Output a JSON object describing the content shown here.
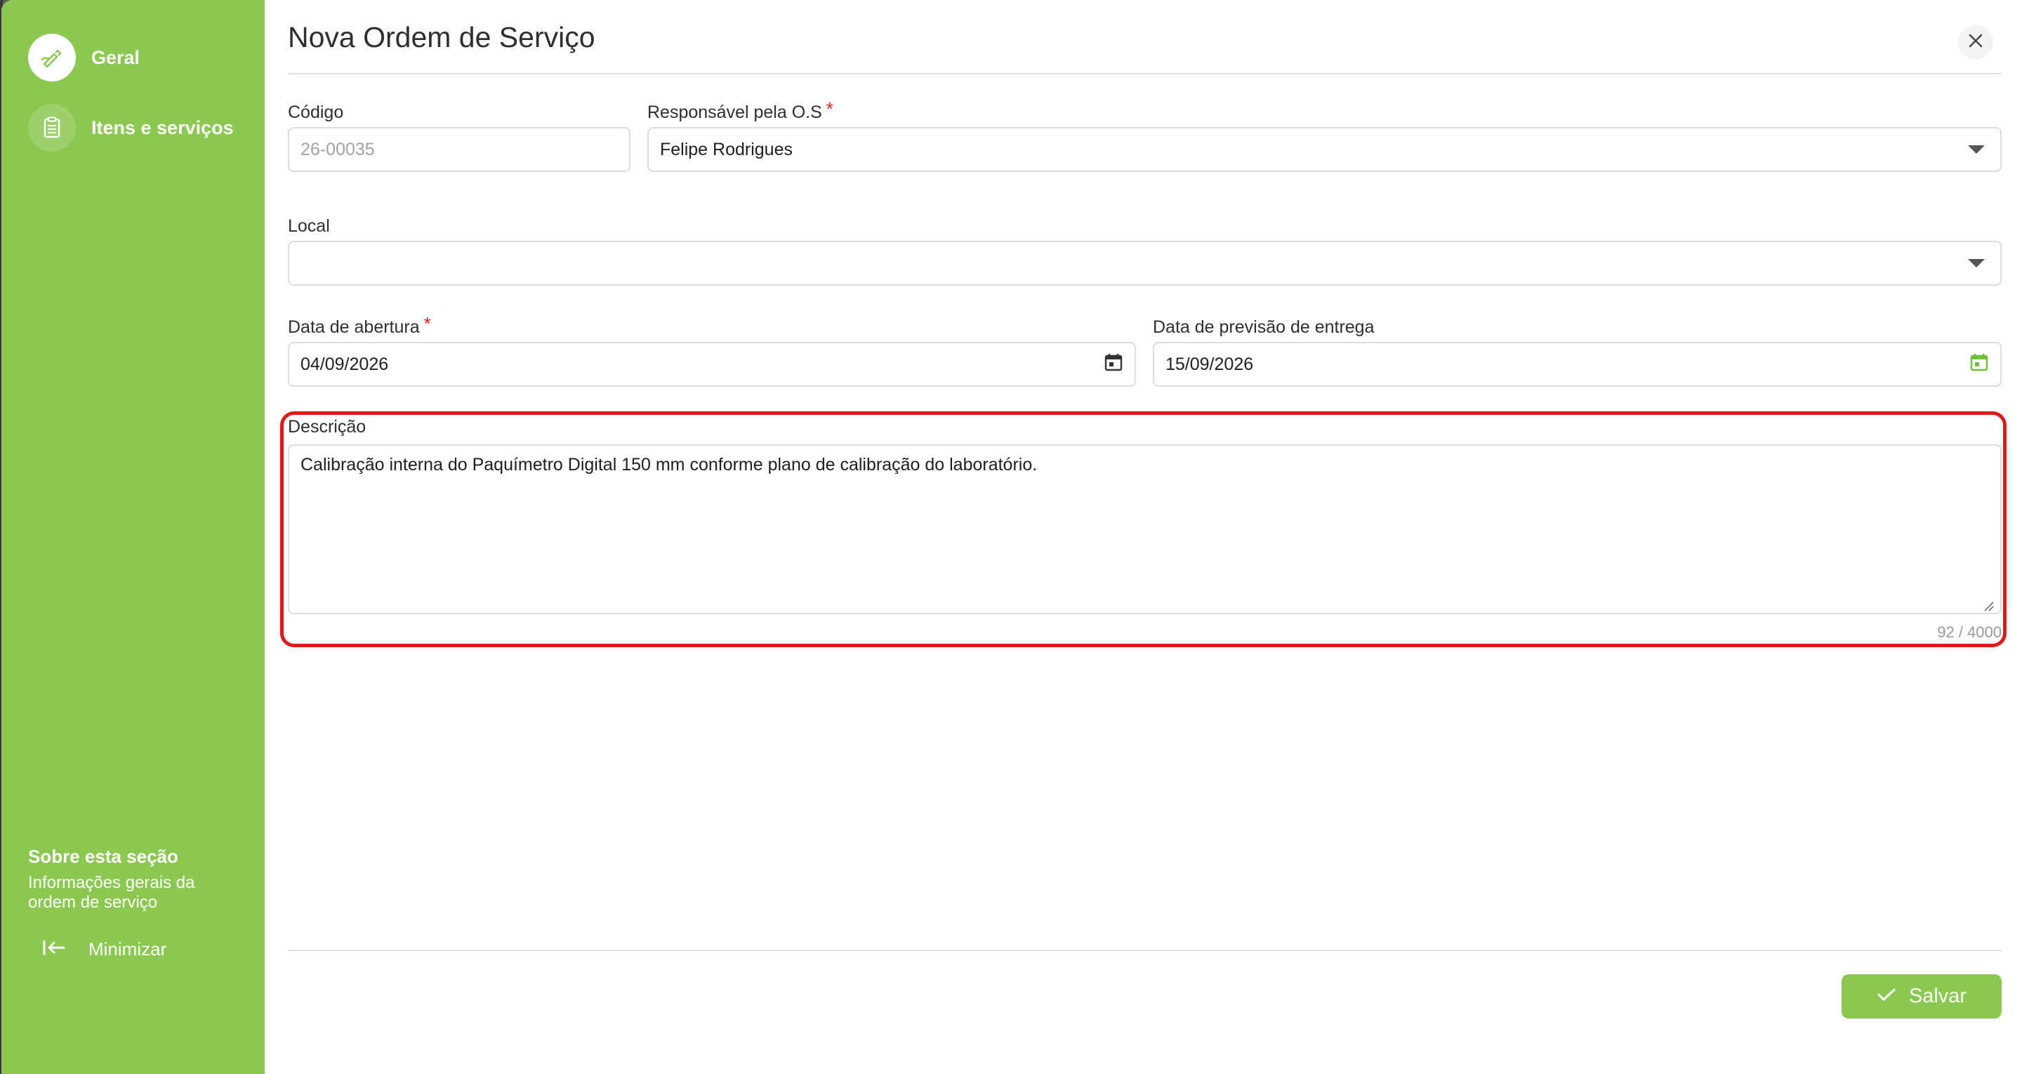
{
  "sidebar": {
    "items": [
      {
        "label": "Geral",
        "icon": "pencil-icon",
        "active": true
      },
      {
        "label": "Itens e serviços",
        "icon": "clipboard-icon",
        "active": false
      }
    ],
    "about": {
      "title": "Sobre esta seção",
      "description": "Informações gerais da ordem de serviço"
    },
    "minimize_label": "Minimizar"
  },
  "main": {
    "title": "Nova Ordem de Serviço",
    "fields": {
      "codigo": {
        "label": "Código",
        "placeholder": "26-00035",
        "value": ""
      },
      "responsavel": {
        "label": "Responsável pela O.S",
        "required": "*",
        "value": "Felipe Rodrigues"
      },
      "local": {
        "label": "Local",
        "value": ""
      },
      "data_abertura": {
        "label": "Data de abertura",
        "required": "*",
        "value": "04/09/2026"
      },
      "data_previsao": {
        "label": "Data de previsão de entrega",
        "value": "15/09/2026"
      },
      "descricao": {
        "label": "Descrição",
        "value": "Calibração interna do Paquímetro Digital 150 mm conforme plano de calibração do laboratório.",
        "counter": "92 / 4000"
      }
    },
    "save_label": "Salvar"
  },
  "colors": {
    "accent": "#8bc850",
    "required": "#e02020",
    "highlight": "#e01818"
  }
}
